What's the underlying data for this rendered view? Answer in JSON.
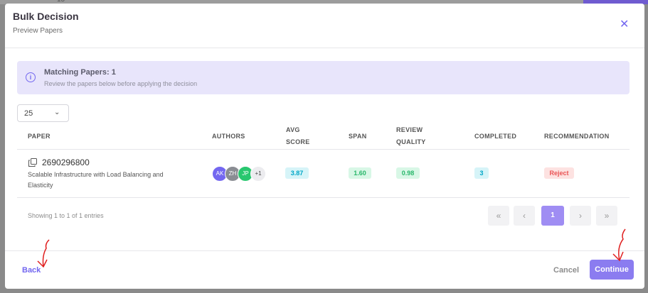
{
  "backdrop": {
    "number": "15"
  },
  "modal": {
    "title": "Bulk Decision",
    "subtitle": "Preview Papers"
  },
  "alert": {
    "title": "Matching Papers: 1",
    "text": "Review the papers below before applying the decision",
    "icon": "info-icon"
  },
  "page_size": {
    "value": "25"
  },
  "table": {
    "headers": {
      "paper": "PAPER",
      "authors": "AUTHORS",
      "avg_score_1": "AVG",
      "avg_score_2": "SCORE",
      "span": "SPAN",
      "review_quality_1": "REVIEW",
      "review_quality_2": "QUALITY",
      "completed": "COMPLETED",
      "recommendation": "RECOMMENDATION"
    },
    "rows": [
      {
        "paper_id": "2690296800",
        "paper_title": "Scalable Infrastructure with Load Balancing and Elasticity",
        "authors": [
          "AK",
          "ZH",
          "JP"
        ],
        "authors_more": "+1",
        "avg_score": "3.87",
        "span": "1.60",
        "review_quality": "0.98",
        "completed": "3",
        "recommendation": "Reject"
      }
    ]
  },
  "footer_info": {
    "entries": "Showing 1 to 1 of 1 entries"
  },
  "pagination": {
    "first": "«",
    "prev": "‹",
    "current": "1",
    "next": "›",
    "last": "»"
  },
  "actions": {
    "back": "Back",
    "cancel": "Cancel",
    "continue": "Continue"
  },
  "colors": {
    "accent": "#7367f0",
    "avatar_ak": "#7367f0",
    "avatar_zh": "#8a8d93",
    "avatar_jp": "#28c76f",
    "badge_info_bg": "#d6f4f8",
    "badge_info_fg": "#00a6c7",
    "badge_success_bg": "#d8f7e6",
    "badge_success_fg": "#28b76a",
    "badge_danger_bg": "#fde2e1",
    "badge_danger_fg": "#ea5455",
    "pointer": "#e02020"
  }
}
